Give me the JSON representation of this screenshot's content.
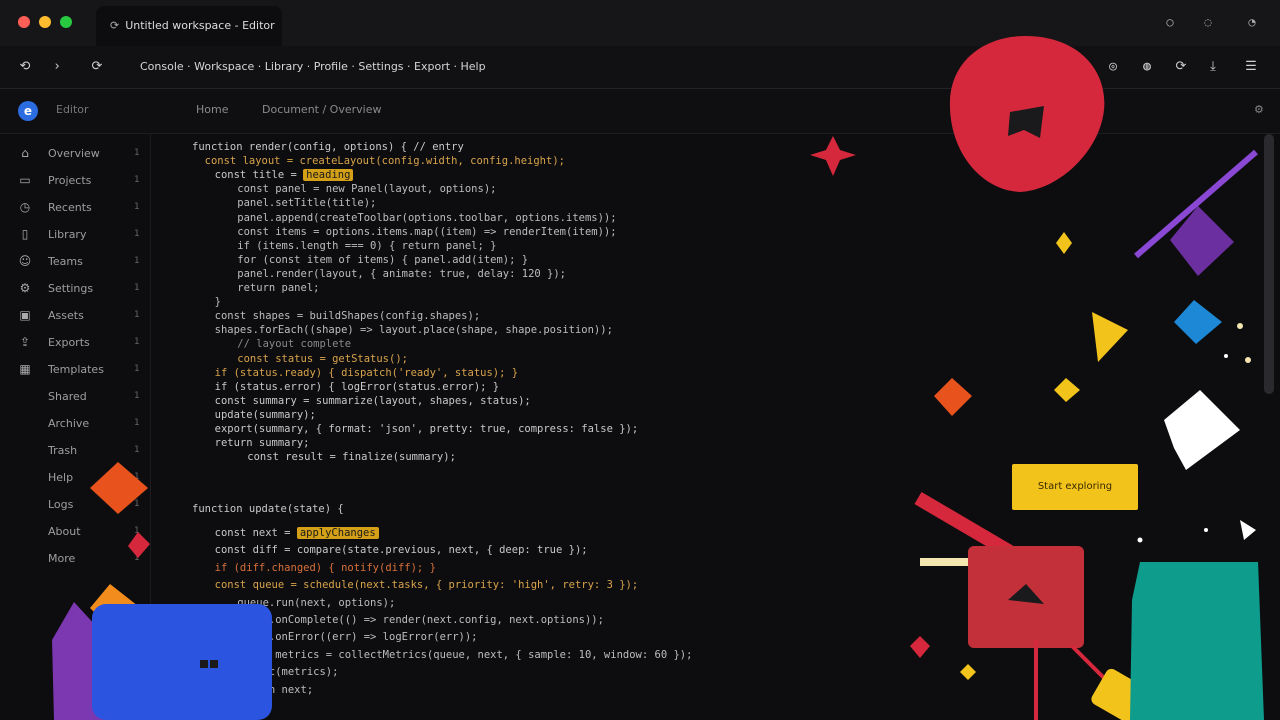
{
  "tab": {
    "title": "Untitled workspace - Editor"
  },
  "window_controls": [
    "minimize-icon",
    "restore-icon",
    "close-icon"
  ],
  "toolbar": {
    "address": "Console · Workspace · Library · Profile · Settings · Export · Help",
    "icons": [
      "bookmark-icon",
      "history-icon",
      "refresh-icon",
      "download-icon",
      "menu-icon"
    ]
  },
  "header": {
    "brand": "Editor",
    "crumbs": [
      "Home",
      "Document / Overview"
    ]
  },
  "sidebar": {
    "items": [
      {
        "label": "Overview",
        "icon": "home-icon",
        "count": "1"
      },
      {
        "label": "Projects",
        "icon": "folder-icon",
        "count": "1"
      },
      {
        "label": "Recents",
        "icon": "clock-icon",
        "count": "1"
      },
      {
        "label": "Library",
        "icon": "book-icon",
        "count": "1"
      },
      {
        "label": "Teams",
        "icon": "users-icon",
        "count": "1"
      },
      {
        "label": "Settings",
        "icon": "gear-icon",
        "count": "1"
      },
      {
        "label": "Assets",
        "icon": "image-icon",
        "count": "1"
      },
      {
        "label": "Exports",
        "icon": "upload-icon",
        "count": "1"
      },
      {
        "label": "Templates",
        "icon": "grid-icon",
        "count": "1"
      },
      {
        "label": "Shared",
        "icon": "share-icon",
        "count": "1"
      },
      {
        "label": "Archive",
        "icon": "archive-icon",
        "count": "1"
      },
      {
        "label": "Trash",
        "icon": "trash-icon",
        "count": "1"
      },
      {
        "label": "Help",
        "icon": "help-icon",
        "count": "1"
      },
      {
        "label": "Logs",
        "icon": "file-icon",
        "count": "1"
      },
      {
        "label": "About",
        "icon": "info-icon",
        "count": "1"
      },
      {
        "label": "More",
        "icon": "dots-icon",
        "count": "1"
      }
    ]
  },
  "code": {
    "lines": [
      {
        "text": "function render(config, options) { // entry",
        "indent": 0,
        "color": "#c9c9c9"
      },
      {
        "text": "  const layout = createLayout(config.width, config.height);",
        "indent": 0,
        "color": "#d8a34a"
      },
      {
        "text": "  const title = ",
        "indent": 1,
        "color": "#c9c9c9",
        "hl": "heading"
      },
      {
        "text": "    const panel = new Panel(layout, options);",
        "indent": 2,
        "color": "#bdbdbd"
      },
      {
        "text": "    panel.setTitle(title);",
        "indent": 2,
        "color": "#bdbdbd"
      },
      {
        "text": "    panel.append(createToolbar(options.toolbar, options.items));",
        "indent": 2,
        "color": "#bdbdbd"
      },
      {
        "text": "    const items = options.items.map((item) => renderItem(item));",
        "indent": 2,
        "color": "#bdbdbd"
      },
      {
        "text": "    if (items.length === 0) { return panel; }",
        "indent": 2,
        "color": "#bdbdbd"
      },
      {
        "text": "    for (const item of items) { panel.add(item); }",
        "indent": 2,
        "color": "#bdbdbd"
      },
      {
        "text": "    panel.render(layout, { animate: true, delay: 120 });",
        "indent": 2,
        "color": "#bdbdbd"
      },
      {
        "text": "    return panel;",
        "indent": 2,
        "color": "#bdbdbd"
      },
      {
        "text": "  }",
        "indent": 1,
        "color": "#bdbdbd"
      },
      {
        "text": "  const shapes = buildShapes(config.shapes);",
        "indent": 1,
        "color": "#bdbdbd"
      },
      {
        "text": "  shapes.forEach((shape) => layout.place(shape, shape.position));",
        "indent": 1,
        "color": "#bdbdbd"
      },
      {
        "text": "    // layout complete",
        "indent": 2,
        "color": "#8a8a8a"
      },
      {
        "text": "    const status = getStatus();",
        "indent": 2,
        "color": "#d8a34a"
      },
      {
        "text": "  if (status.ready) { dispatch('ready', status); }",
        "indent": 1,
        "color": "#d8a34a"
      },
      {
        "text": "  if (status.error) { logError(status.error); }",
        "indent": 1,
        "color": "#c9c9c9"
      },
      {
        "text": "  const summary = summarize(layout, shapes, status);",
        "indent": 1,
        "color": "#c9c9c9"
      },
      {
        "text": "  update(summary);",
        "indent": 1,
        "color": "#c9c9c9"
      },
      {
        "text": "  export(summary, { format: 'json', pretty: true, compress: false });",
        "indent": 1,
        "color": "#c9c9c9"
      },
      {
        "text": "  return summary;",
        "indent": 1,
        "color": "#c9c9c9"
      },
      {
        "text": "    const result = finalize(summary);",
        "indent": 3,
        "color": "#c9c9c9"
      }
    ],
    "section": "function update(state) {",
    "lines2": [
      {
        "text": "  const next = ",
        "indent": 1,
        "color": "#c9c9c9",
        "hl": "applyChanges"
      },
      {
        "text": "  const diff = compare(state.previous, next, { deep: true });",
        "indent": 1,
        "color": "#c9c9c9"
      },
      {
        "text": "  if (diff.changed) { notify(diff); }",
        "indent": 1,
        "color": "#d8703a"
      },
      {
        "text": "  const queue = schedule(next.tasks, { priority: 'high', retry: 3 });",
        "indent": 1,
        "color": "#d8a34a"
      },
      {
        "text": "    queue.run(next, options);",
        "indent": 2,
        "color": "#bdbdbd"
      },
      {
        "text": "    queue.onComplete(() => render(next.config, next.options));",
        "indent": 2,
        "color": "#bdbdbd"
      },
      {
        "text": "    queue.onError((err) => logError(err));",
        "indent": 2,
        "color": "#bdbdbd"
      },
      {
        "text": "    const metrics = collectMetrics(queue, next, { sample: 10, window: 60 });",
        "indent": 2,
        "color": "#bdbdbd"
      },
      {
        "text": "    report(metrics);",
        "indent": 2,
        "color": "#bdbdbd"
      },
      {
        "text": "    return next;",
        "indent": 2,
        "color": "#bdbdbd"
      },
      {
        "text": "  }",
        "indent": 1,
        "color": "#bdbdbd"
      }
    ]
  },
  "cta": {
    "label": "Start exploring"
  },
  "colors": {
    "bg": "#0d0d10",
    "accent": "#f2c31b",
    "red": "#d6283c",
    "teal": "#0e9c8c",
    "blue": "#2b55e0"
  }
}
